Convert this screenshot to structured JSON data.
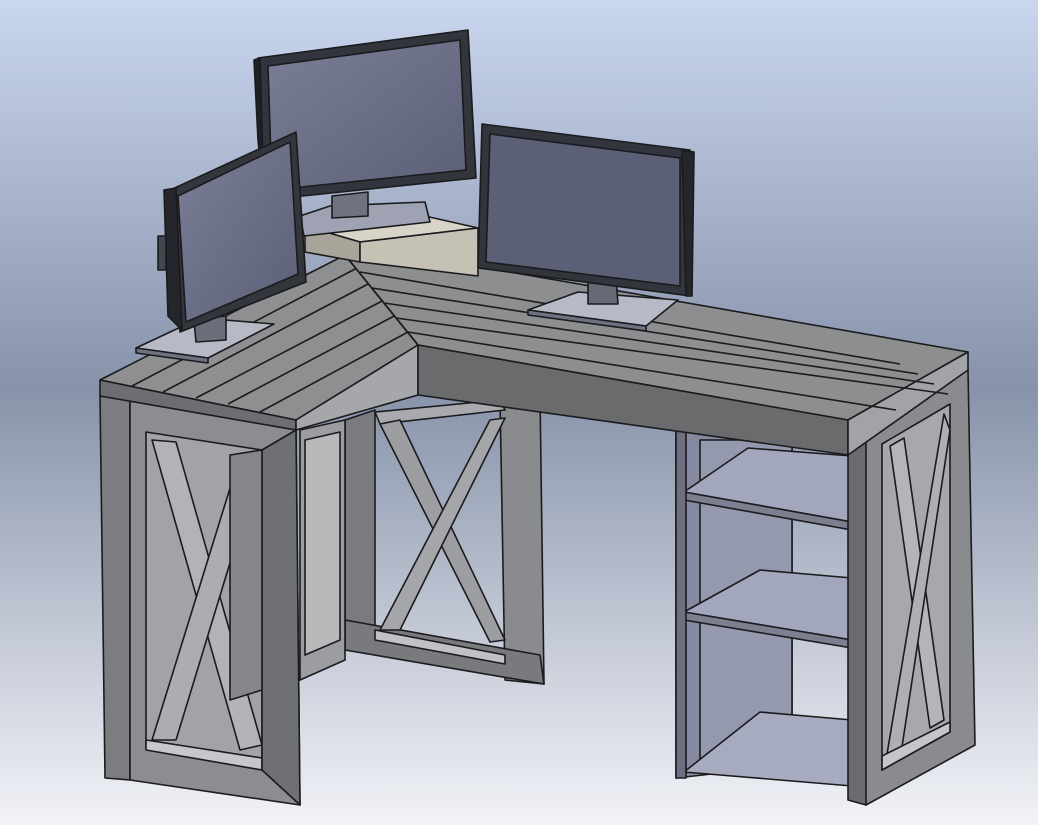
{
  "scene": {
    "subject": "",
    "colors": {
      "bg_top": "#c9d6ef",
      "bg_mid": "#8793aa",
      "bg_bottom": "#f2f3f8",
      "wood_top": "#8e8f90",
      "wood_dark": "#6b6c6e",
      "wood_light": "#b4b5b8",
      "panel": "#8f93a8",
      "shelf": "#a3a7bd",
      "screen": "#6d7188",
      "bezel": "#2a2c33",
      "edge": "#1b1b1e"
    },
    "objects": [
      "desk-top-left-wing",
      "desk-top-right-wing",
      "left-x-leg-frame",
      "middle-x-leg-frame",
      "right-x-leg-frame",
      "shelf-unit",
      "monitor-left",
      "monitor-center",
      "monitor-right",
      "monitor-riser"
    ]
  }
}
